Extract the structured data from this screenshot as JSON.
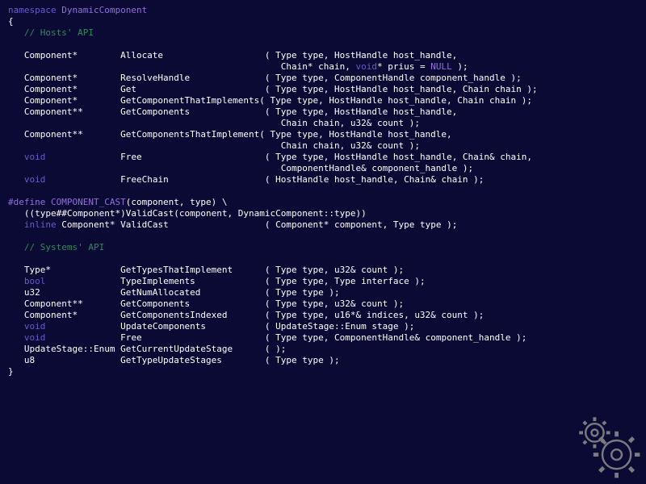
{
  "line1_a": "namespace",
  "line1_b": "DynamicComponent",
  "brace_open": "{",
  "comment_hosts": "// Hosts' API",
  "h1a": "   Component*        Allocate                   ( Type type, HostHandle host_handle,",
  "h1b": "                                                   Chain* chain, ",
  "h1c": "void",
  "h1d": "* prius = ",
  "h1e": "NULL",
  "h1f": " );",
  "h2": "   Component*        ResolveHandle              ( Type type, ComponentHandle component_handle );",
  "h3": "   Component*        Get                        ( Type type, HostHandle host_handle, Chain chain );",
  "h4": "   Component*        GetComponentThatImplements( Type type, HostHandle host_handle, Chain chain );",
  "h5a": "   Component**       GetComponents              ( Type type, HostHandle host_handle,",
  "h5b": "                                                   Chain chain, u32& count );",
  "h6a": "   Component**       GetComponentsThatImplement( Type type, HostHandle host_handle,",
  "h6b": "                                                   Chain chain, u32& count );",
  "h7a": "              Free                       ( Type type, HostHandle host_handle, Chain& chain,",
  "h7b": "                                                   ComponentHandle& component_handle );",
  "h8": "              FreeChain                  ( HostHandle host_handle, Chain& chain );",
  "def_a": "#define",
  "def_b": "COMPONENT_CAST",
  "def_c": "(component, type) \\",
  "def_d": "   ((type##Component*)ValidCast(component, DynamicComponent::type))",
  "inl_a": "inline",
  "inl_b": " Component* ValidCast                  ( Component* component, Type type );",
  "comment_systems": "// Systems' API",
  "s1": "   Type*             GetTypesThatImplement      ( Type type, u32& count );",
  "s2a": "bool",
  "s2b": "              TypeImplements             ( Type type, Type interface );",
  "s3": "   u32               GetNumAllocated            ( Type type );",
  "s4": "   Component**       GetComponents              ( Type type, u32& count );",
  "s5": "   Component*        GetComponentsIndexed       ( Type type, u16*& indices, u32& count );",
  "s6a": "void",
  "s6b": "              UpdateComponents           ( UpdateStage::Enum stage );",
  "s7a": "void",
  "s7b": "              Free                       ( Type type, ComponentHandle& component_handle );",
  "s8": "   UpdateStage::Enum GetCurrentUpdateStage      ( );",
  "s9": "   u8                GetTypeUpdateStages        ( Type type );",
  "brace_close": "}",
  "void": "void",
  "pad3": "   "
}
